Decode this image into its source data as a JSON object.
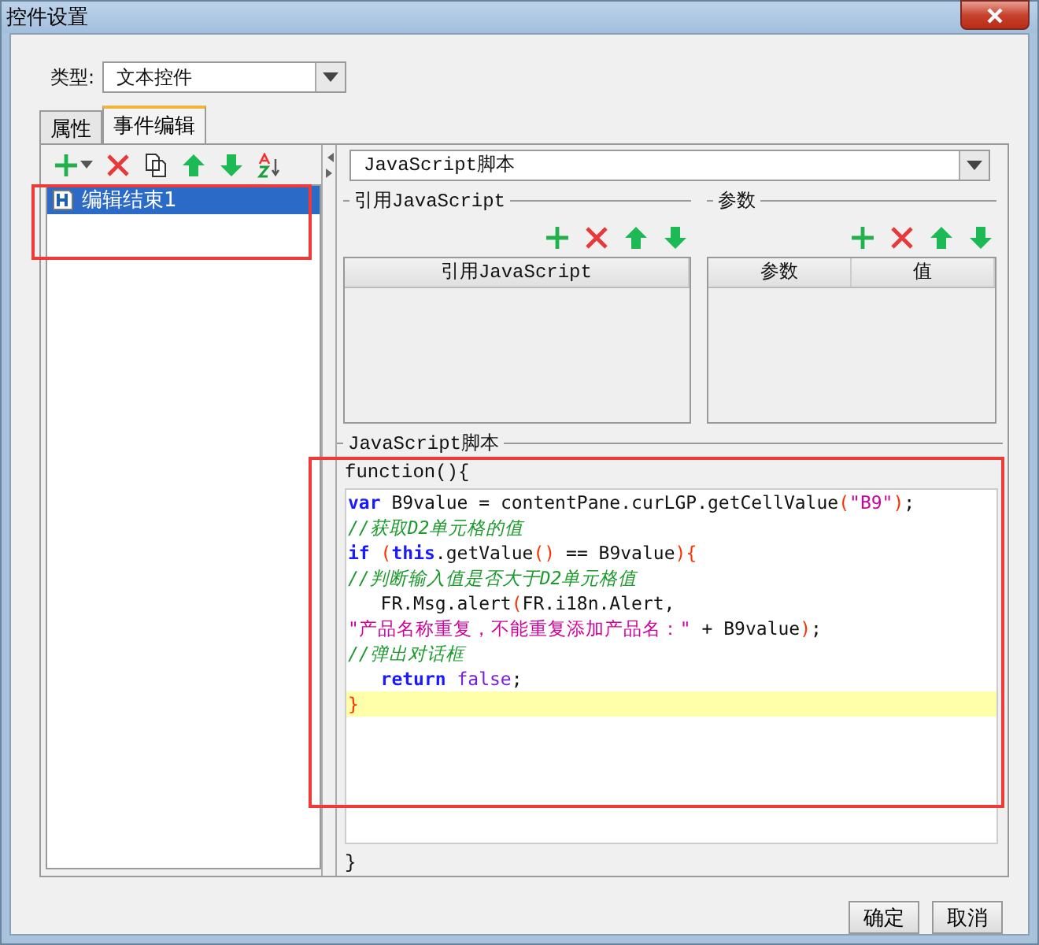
{
  "window": {
    "title": "控件设置"
  },
  "type_field": {
    "label": "类型:",
    "value": "文本控件"
  },
  "tabs": [
    {
      "label": "属性",
      "selected": false
    },
    {
      "label": "事件编辑",
      "selected": true
    }
  ],
  "events": [
    {
      "label": "编辑结束1",
      "selected": true
    }
  ],
  "script_type": {
    "value": "JavaScript脚本"
  },
  "references": {
    "title": "引用JavaScript",
    "columns": [
      "引用JavaScript"
    ]
  },
  "parameters": {
    "title": "参数",
    "columns": [
      "参数",
      "值"
    ]
  },
  "script": {
    "title": "JavaScript脚本",
    "header": "function(){",
    "footer": "}",
    "lines": [
      {
        "current": false,
        "tokens": [
          {
            "text": "var",
            "kind": "keyword"
          },
          {
            "text": " B9value = contentPane.curLGP.getCellValue",
            "kind": "plain"
          },
          {
            "text": "(",
            "kind": "bracket"
          },
          {
            "text": "\"B9\"",
            "kind": "string"
          },
          {
            "text": ")",
            "kind": "bracket"
          },
          {
            "text": ";",
            "kind": "plain"
          }
        ]
      },
      {
        "current": false,
        "tokens": [
          {
            "text": "//获取D2单元格的值",
            "kind": "comment"
          }
        ]
      },
      {
        "current": false,
        "tokens": [
          {
            "text": "if",
            "kind": "keyword"
          },
          {
            "text": " (",
            "kind": "bracket"
          },
          {
            "text": "this",
            "kind": "keyword"
          },
          {
            "text": ".getValue",
            "kind": "plain"
          },
          {
            "text": "()",
            "kind": "bracket"
          },
          {
            "text": " == B9value",
            "kind": "plain"
          },
          {
            "text": "){",
            "kind": "bracket"
          }
        ]
      },
      {
        "current": false,
        "tokens": [
          {
            "text": "//判断输入值是否大于D2单元格值",
            "kind": "comment"
          }
        ]
      },
      {
        "current": false,
        "tokens": [
          {
            "text": "   FR.Msg.alert",
            "kind": "plain"
          },
          {
            "text": "(",
            "kind": "bracket"
          },
          {
            "text": "FR.i18n.Alert,",
            "kind": "plain"
          }
        ]
      },
      {
        "current": false,
        "tokens": [
          {
            "text": "\"产品名称重复，不能重复添加产品名：\"",
            "kind": "string"
          },
          {
            "text": " + B9value",
            "kind": "plain"
          },
          {
            "text": ")",
            "kind": "bracket"
          },
          {
            "text": ";",
            "kind": "plain"
          }
        ]
      },
      {
        "current": false,
        "tokens": [
          {
            "text": "//弹出对话框",
            "kind": "comment"
          }
        ]
      },
      {
        "current": false,
        "tokens": [
          {
            "text": "   return",
            "kind": "keyword"
          },
          {
            "text": " false",
            "kind": "literal"
          },
          {
            "text": ";",
            "kind": "plain"
          }
        ]
      },
      {
        "current": true,
        "tokens": [
          {
            "text": "}",
            "kind": "bracket"
          }
        ]
      }
    ]
  },
  "buttons": [
    "确定",
    "取消"
  ]
}
